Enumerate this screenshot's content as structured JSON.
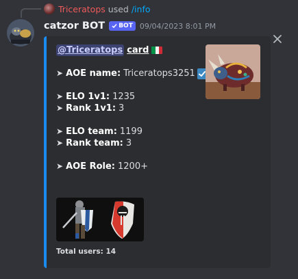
{
  "reply": {
    "username": "Triceratops",
    "used_text": "used",
    "command": "/info"
  },
  "message": {
    "author": "catzor BOT",
    "bot_tag": "BOT",
    "timestamp": "09/04/2023 8:01 PM"
  },
  "embed": {
    "accent_color": "#1a8bef",
    "mention": "@Triceratops",
    "title_word": "card",
    "flag": "italy-flag-icon",
    "fields": [
      {
        "arrow": "➤",
        "label": "AOE name:",
        "value": "Triceratops3251",
        "verified": true
      },
      {
        "arrow": "➤",
        "label": "ELO 1v1:",
        "value": "1235"
      },
      {
        "arrow": "➤",
        "label": "Rank 1v1:",
        "value": "3"
      },
      {
        "arrow": "➤",
        "label": "ELO team:",
        "value": "1199"
      },
      {
        "arrow": "➤",
        "label": "Rank team:",
        "value": "3"
      },
      {
        "arrow": "➤",
        "label": "AOE Role:",
        "value": "1200+"
      }
    ],
    "footer": "Total users: 14"
  }
}
